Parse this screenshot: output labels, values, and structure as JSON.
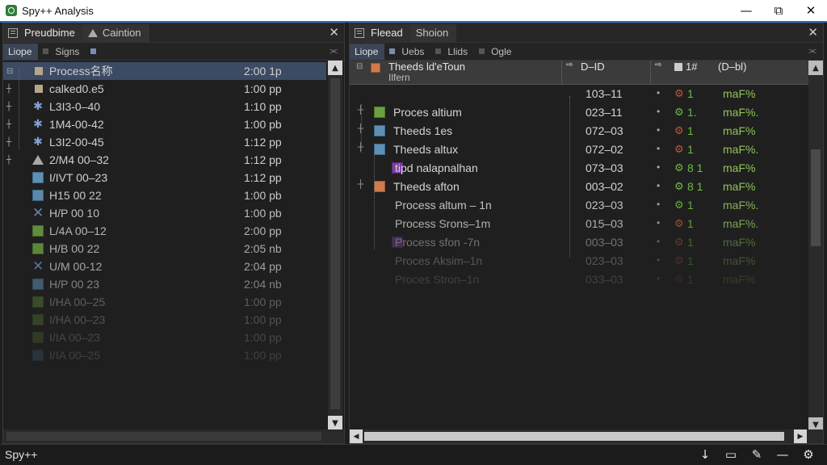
{
  "window": {
    "title": "Spy++ Analysis",
    "minimize": "—",
    "maximize": "⧉",
    "close": "✕"
  },
  "left_pane": {
    "tabs": [
      {
        "label": "Preudbime"
      },
      {
        "label": "Caintion"
      }
    ],
    "close": "✕",
    "subtabs": [
      {
        "label": "Liope"
      },
      {
        "label": "Signs"
      }
    ],
    "pin": "⫘",
    "rows": [
      {
        "name": "Process名称",
        "time": "2:00 1p",
        "icon": "tan-square",
        "selected": true
      },
      {
        "name": "calked0.e5",
        "time": "1:00 pp",
        "icon": "tan-square"
      },
      {
        "name": "L3I3-0–40",
        "time": "1:10 pp",
        "icon": "star-icon"
      },
      {
        "name": "1M4-00-42",
        "time": "1:00 pb",
        "icon": "star-icon"
      },
      {
        "name": "L3I2-00-45",
        "time": "1:12 pp",
        "icon": "star-icon"
      },
      {
        "name": "2/M4 00–32",
        "time": "1:12 pp",
        "icon": "triangle-icon"
      },
      {
        "name": "I/IVT 00–23",
        "time": "1:12 pp",
        "icon": "blue-square"
      },
      {
        "name": "H15 00 22",
        "time": "1:00 pb",
        "icon": "blue-square"
      },
      {
        "name": "H/P 00 10",
        "time": "1:00 pb",
        "icon": "x-icon"
      },
      {
        "name": "L/4A 00–12",
        "time": "2:00 pp",
        "icon": "green-square"
      },
      {
        "name": "H/B 00 22",
        "time": "2:05 nb",
        "icon": "green-square"
      },
      {
        "name": "U/M 00-12",
        "time": "2:04 pp",
        "icon": "x-icon"
      },
      {
        "name": "H/P 00 23",
        "time": "2:04 nb",
        "icon": "blue-square"
      },
      {
        "name": "I/HA 00–25",
        "time": "1:00 pp",
        "icon": "green-square"
      },
      {
        "name": "I/HA 00–23",
        "time": "1:00 pp",
        "icon": "green-square"
      },
      {
        "name": "I/IA 00–23",
        "time": "1:00 pp",
        "icon": "green-square"
      },
      {
        "name": "I/IA 00–25",
        "time": "1:00 pp",
        "icon": "blue-square"
      }
    ]
  },
  "right_pane": {
    "tabs": [
      {
        "label": "Fleead"
      },
      {
        "label": "Shoion"
      }
    ],
    "close": "✕",
    "subtabs": [
      {
        "label": "Liope"
      },
      {
        "label": "Uebs"
      },
      {
        "label": "Llids"
      },
      {
        "label": "Ogle"
      }
    ],
    "pin": "⫘",
    "headers": {
      "name": "Theeds ld'eToun",
      "name2": "Ilfern",
      "tid": "D–ID",
      "flag": "1#",
      "pct": "(D–bl)"
    },
    "rows": [
      {
        "name": "",
        "tid": "103–11",
        "num": "1",
        "pct": "maF%",
        "icon": "none",
        "indent": 0,
        "gear": "red"
      },
      {
        "name": "Proces altium",
        "tid": "023–11",
        "num": "1.",
        "pct": "maF%.",
        "icon": "green-square",
        "indent": 1,
        "gear": "green"
      },
      {
        "name": "Theeds 1es",
        "tid": "072–03",
        "num": "1",
        "pct": "maF%",
        "icon": "blue-square",
        "indent": 1,
        "gear": "red"
      },
      {
        "name": "Theeds altux",
        "tid": "072–02",
        "num": "1",
        "pct": "maF%.",
        "icon": "blue-square",
        "indent": 1,
        "gear": "red"
      },
      {
        "name": "tipd nalapnalhan",
        "tid": "073–03",
        "num": "8 1",
        "pct": "maF%",
        "icon": "purple-square",
        "indent": 2,
        "gear": "green"
      },
      {
        "name": "Theeds afton",
        "tid": "003–02",
        "num": "8 1",
        "pct": "maF%",
        "icon": "orange-square",
        "indent": 1,
        "gear": "green"
      },
      {
        "name": "Process altum – 1n",
        "tid": "023–03",
        "num": "1",
        "pct": "maF%.",
        "icon": "none",
        "indent": 2,
        "gear": "green"
      },
      {
        "name": "Process Srons–1m",
        "tid": "015–03",
        "num": "1",
        "pct": "maF%.",
        "icon": "none",
        "indent": 2,
        "gear": "red"
      },
      {
        "name": "Process sfon -7n",
        "tid": "003–03",
        "num": "1",
        "pct": "maF%",
        "icon": "purple-square",
        "indent": 2,
        "gear": "red"
      },
      {
        "name": "Proces Aksim–1n",
        "tid": "023–03",
        "num": "1",
        "pct": "maF%",
        "icon": "none",
        "indent": 2,
        "gear": "red"
      },
      {
        "name": "Proces Stron–1n",
        "tid": "033–03",
        "num": "1",
        "pct": "maF%",
        "icon": "none",
        "indent": 2,
        "gear": "red"
      }
    ]
  },
  "status": {
    "text": "Spy++"
  },
  "colors": {
    "accent": "#2a6fb8",
    "selection": "#3c4a63",
    "positive": "#6bbd3b",
    "gear_red": "#c0563a"
  }
}
